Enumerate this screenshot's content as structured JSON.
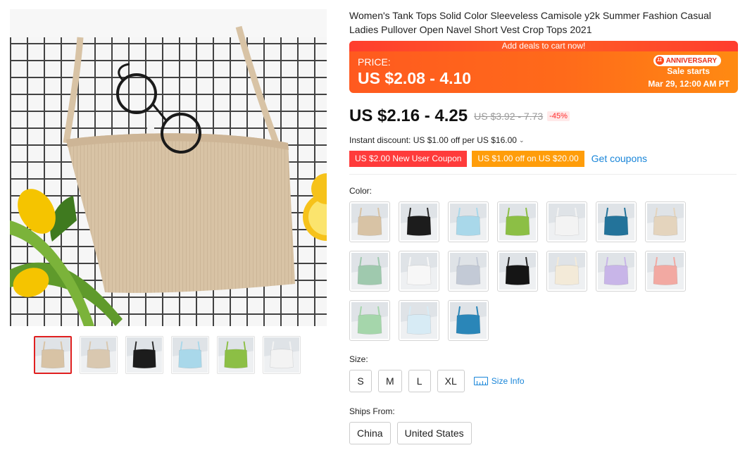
{
  "product": {
    "title": "Women's Tank Tops Solid Color Sleeveless Camisole y2k Summer Fashion Casual Ladies Pullover Open Navel Short Vest Crop Tops 2021"
  },
  "promo": {
    "banner": "Add deals to cart now!",
    "price_label": "PRICE:",
    "price": "US $2.08 - 4.10",
    "badge": "ANNIVERSARY",
    "sale_starts": "Sale starts",
    "sale_date": "Mar 29, 12:00 AM PT"
  },
  "pricing": {
    "current": "US $2.16 - 4.25",
    "original": "US $3.92 - 7.73",
    "discount": "-45%"
  },
  "instant_discount": "Instant discount: US $1.00 off per US $16.00",
  "coupons": {
    "new_user": "US $2.00 New User Coupon",
    "store": "US $1.00 off on US $20.00",
    "get_link": "Get coupons"
  },
  "color": {
    "label": "Color:",
    "swatches": [
      {
        "name": "khaki",
        "hex": "#d8c3a5"
      },
      {
        "name": "black",
        "hex": "#1c1c1c"
      },
      {
        "name": "light-blue",
        "hex": "#a9d8ea"
      },
      {
        "name": "green",
        "hex": "#8cbf45"
      },
      {
        "name": "white",
        "hex": "#f3f3f3"
      },
      {
        "name": "teal",
        "hex": "#23739a"
      },
      {
        "name": "beige",
        "hex": "#e4d4bd"
      },
      {
        "name": "sage",
        "hex": "#9fc9ae"
      },
      {
        "name": "white-2",
        "hex": "#f7f7f7"
      },
      {
        "name": "grey-blue",
        "hex": "#c3cad6"
      },
      {
        "name": "black-2",
        "hex": "#151515"
      },
      {
        "name": "cream",
        "hex": "#f3ead8"
      },
      {
        "name": "lavender",
        "hex": "#c8b5e8"
      },
      {
        "name": "pink",
        "hex": "#f2a9a2"
      },
      {
        "name": "mint",
        "hex": "#a5d6ab"
      },
      {
        "name": "baby-blue",
        "hex": "#d7ebf5"
      },
      {
        "name": "blue",
        "hex": "#2a86b8"
      }
    ]
  },
  "size": {
    "label": "Size:",
    "options": [
      "S",
      "M",
      "L",
      "XL"
    ],
    "info": "Size Info"
  },
  "ships": {
    "label": "Ships From:",
    "options": [
      "China",
      "United States"
    ]
  },
  "gallery": {
    "thumbs": [
      {
        "name": "khaki",
        "hex": "#d8c3a5"
      },
      {
        "name": "beige",
        "hex": "#d9c8b0"
      },
      {
        "name": "black",
        "hex": "#1c1c1c"
      },
      {
        "name": "light-blue",
        "hex": "#a9d8ea"
      },
      {
        "name": "green",
        "hex": "#8cbf45"
      },
      {
        "name": "white",
        "hex": "#f3f3f3"
      }
    ]
  },
  "colors": {
    "accent": "#ff6a1a",
    "discount_red": "#ff2a2a",
    "link_blue": "#1a86d9"
  }
}
